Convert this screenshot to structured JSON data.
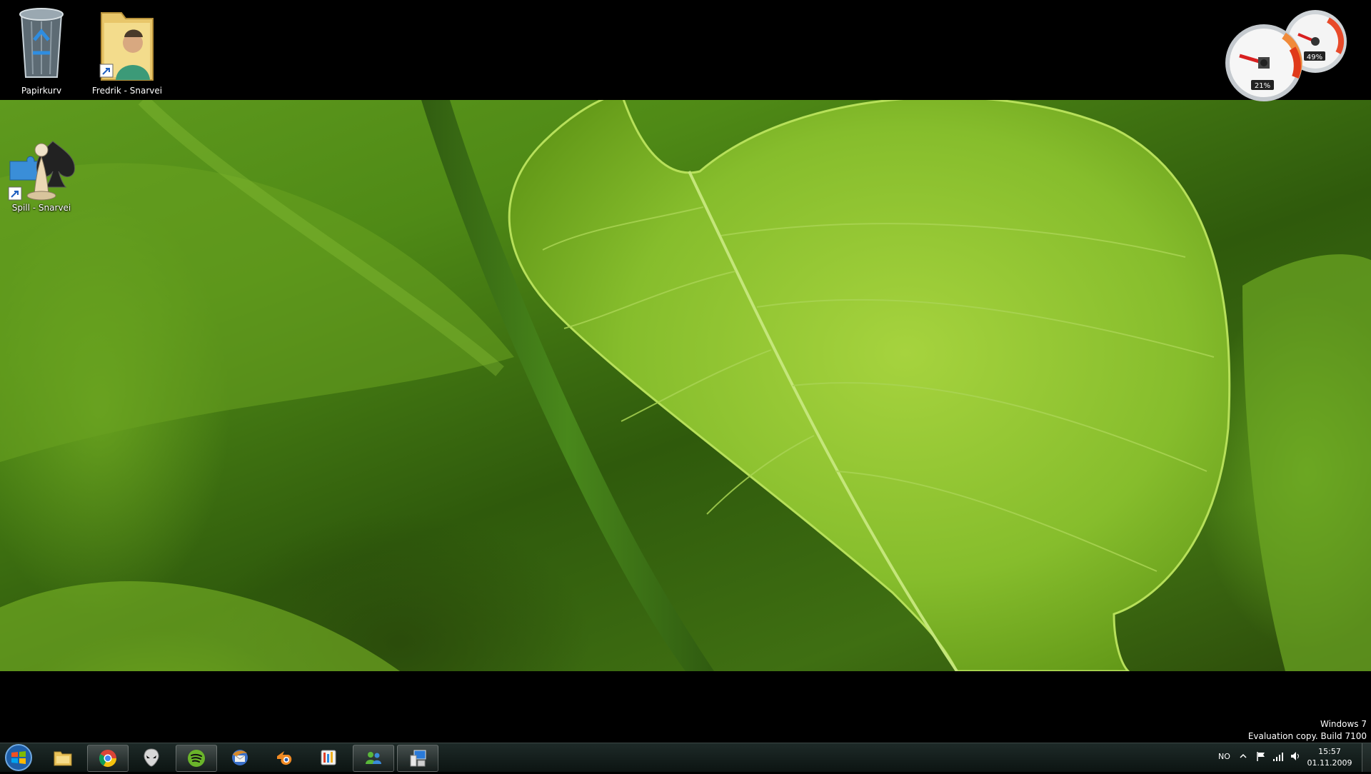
{
  "desktop": {
    "icons": [
      {
        "label": "Papirkurv",
        "icon": "recycle-bin-icon"
      },
      {
        "label": "Fredrik - Snarvei",
        "icon": "user-folder-shortcut-icon"
      },
      {
        "label": "Spill - Snarvei",
        "icon": "games-shortcut-icon"
      }
    ],
    "watermark": {
      "line1": "Windows 7",
      "line2": "Evaluation copy. Build 7100"
    }
  },
  "gadget": {
    "name": "cpu-meter",
    "cpu_percent_label": "21%",
    "memory_percent_label": "49%",
    "cpu_value": 21,
    "memory_value": 49
  },
  "taskbar": {
    "start": {
      "icon": "windows-start-icon"
    },
    "pinned": [
      {
        "icon": "windows-explorer-icon",
        "running": false
      },
      {
        "icon": "chrome-icon",
        "running": true
      },
      {
        "icon": "alien-icon",
        "running": false
      },
      {
        "icon": "spotify-icon",
        "running": true
      },
      {
        "icon": "thunderbird-icon",
        "running": false
      },
      {
        "icon": "blender-icon",
        "running": false
      },
      {
        "icon": "app-icon",
        "running": false
      },
      {
        "icon": "messenger-icon",
        "running": true
      },
      {
        "icon": "control-panel-icon",
        "running": true
      }
    ],
    "tray": {
      "language": "NO",
      "icons": [
        "show-hidden-icons-chevron",
        "action-center-flag-icon",
        "network-icon",
        "volume-icon"
      ],
      "time": "15:57",
      "date": "01.11.2009"
    }
  },
  "colors": {
    "wallpaper_leaf": "#7fb52c",
    "taskbar": "#111a18",
    "gadget_red": "#e02020"
  }
}
